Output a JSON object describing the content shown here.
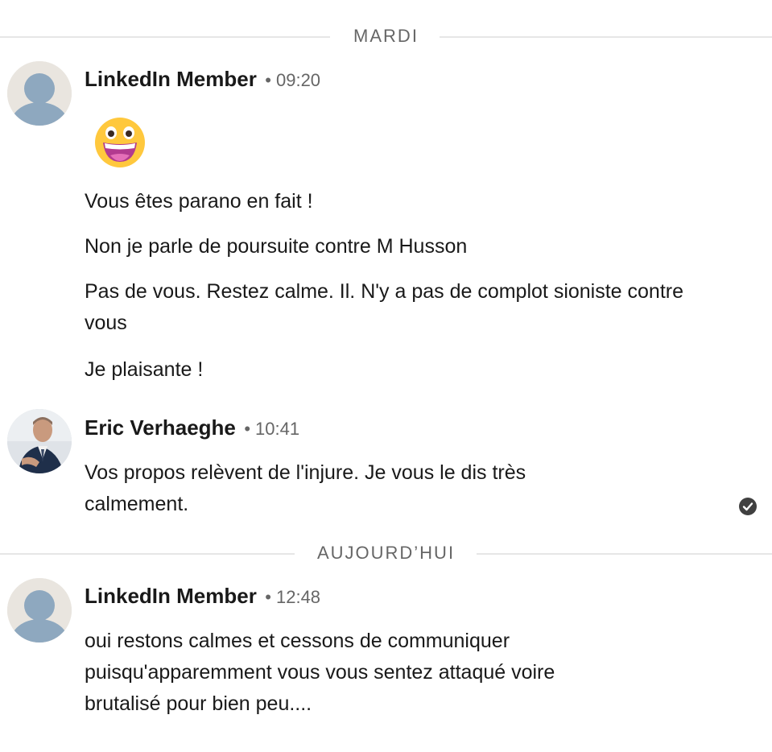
{
  "days": [
    {
      "label": "MARDI",
      "groups": [
        {
          "sender": "LinkedIn Member",
          "time": "09:20",
          "avatar": "default-avatar-icon",
          "emoji": "grinning-face-icon",
          "messages": [
            "Vous êtes parano en fait !",
            "Non je parle de poursuite contre M Husson",
            "Pas de vous. Restez calme. Il. N'y a pas de complot sioniste contre vous",
            "Je plaisante !"
          ]
        },
        {
          "sender": "Eric Verhaeghe",
          "time": "10:41",
          "avatar": "profile-photo",
          "messages": [
            "Vos propos relèvent de l'injure. Je vous le dis très calmement."
          ],
          "read_receipt": "check-circle-icon"
        }
      ]
    },
    {
      "label": "AUJOURD’HUI",
      "groups": [
        {
          "sender": "LinkedIn Member",
          "time": "12:48",
          "avatar": "default-avatar-icon",
          "messages": [
            "oui restons calmes et cessons de communiquer puisqu'apparemment vous vous sentez attaqué voire brutalisé pour bien peu...."
          ]
        }
      ]
    }
  ],
  "separator": "•",
  "colors": {
    "text": "#191919",
    "muted": "#666666",
    "divider": "#e6e6e6",
    "avatar_bg": "#e9e5df",
    "avatar_figure": "#8ea8bf",
    "emoji_face": "#ffc83d"
  }
}
